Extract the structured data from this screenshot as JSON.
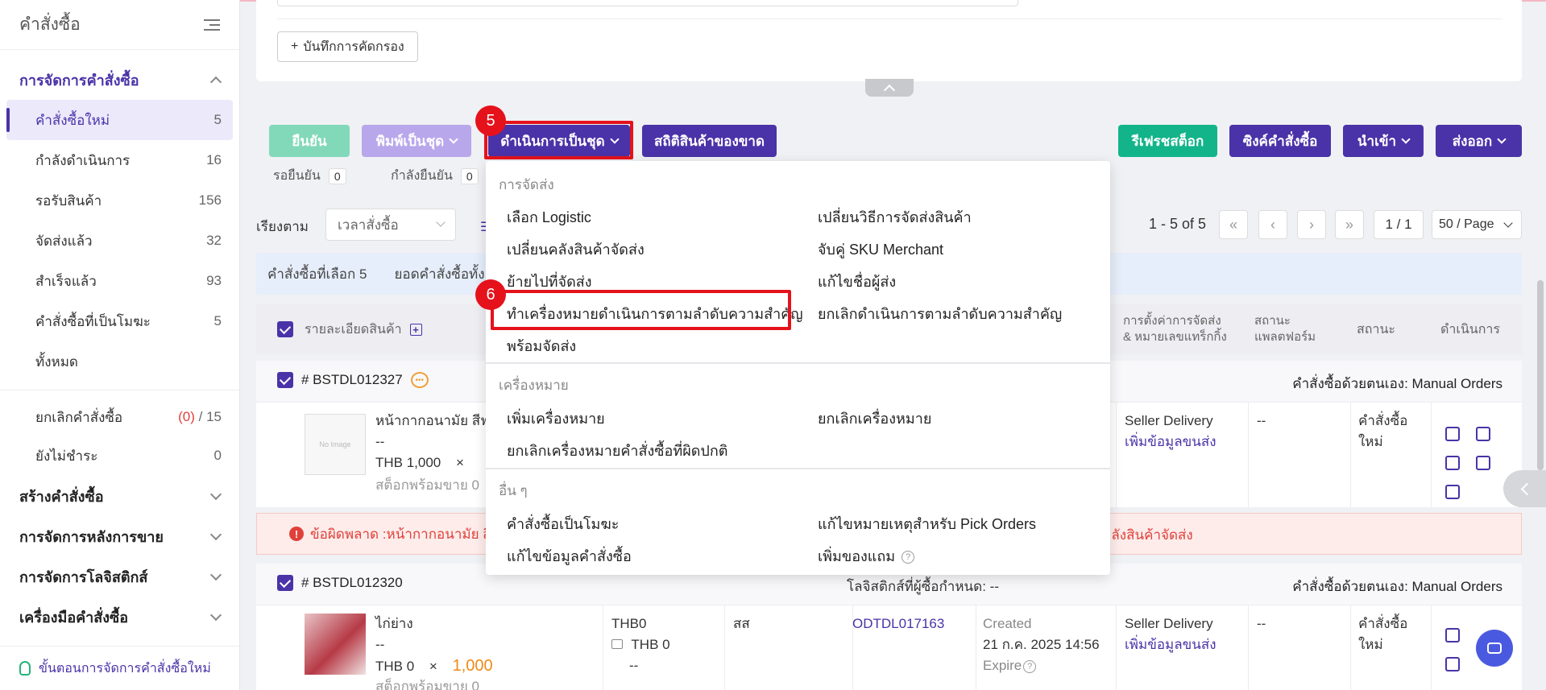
{
  "sidebar": {
    "title": "คำสั่งซื้อ",
    "group_manage": "การจัดการคำสั่งซื้อ",
    "items": [
      {
        "label": "คำสั่งซื้อใหม่",
        "count": "5"
      },
      {
        "label": "กำลังดำเนินการ",
        "count": "16"
      },
      {
        "label": "รอรับสินค้า",
        "count": "156"
      },
      {
        "label": "จัดส่งแล้ว",
        "count": "32"
      },
      {
        "label": "สำเร็จแล้ว",
        "count": "93"
      },
      {
        "label": "คำสั่งซื้อที่เป็นโมฆะ",
        "count": "5"
      },
      {
        "label": "ทั้งหมด",
        "count": ""
      }
    ],
    "cancel": {
      "label": "ยกเลิกคำสั่งซื้อ",
      "pending": "(0)",
      "slash": "/",
      "total": "15"
    },
    "unpaid": {
      "label": "ยังไม่ชำระ",
      "count": "0"
    },
    "groups": [
      "สร้างคำสั่งซื้อ",
      "การจัดการหลังการขาย",
      "การจัดการโลจิสติกส์",
      "เครื่องมือคำสั่งซื้อ"
    ],
    "footer": "ขั้นตอนการจัดการคำสั่งซื้อใหม่"
  },
  "filter": {
    "save_label": "บันทึกการคัดกรอง",
    "plus": "+"
  },
  "toolbar": {
    "confirm": "ยืนยัน",
    "print_batch": "พิมพ์เป็นชุด",
    "batch_process": "ดำเนินการเป็นชุด",
    "stock_stats": "สถิติสินค้าของขาด",
    "refresh_stock": "รีเฟรชสต็อก",
    "sync_orders": "ซิงค์คำสั่งซื้อ",
    "import": "นำเข้า",
    "export": "ส่งออก",
    "step5": "5",
    "step6": "6"
  },
  "status": {
    "pending_label": "รอยืนยัน",
    "pending_count": "0",
    "confirming_label": "กำลังยืนยัน",
    "confirming_count": "0"
  },
  "sort": {
    "label": "เรียงตาม",
    "value": "เวลาสั่งซื้อ",
    "icon": "☰"
  },
  "pager": {
    "summary": "1 - 5 of 5",
    "first": "«",
    "prev": "‹",
    "next": "›",
    "last": "»",
    "page": "1 / 1",
    "size": "50 / Page"
  },
  "selection": {
    "selected": "คำสั่งซื้อที่เลือก 5",
    "total": "ยอดคำสั่งซื้อทั้ง"
  },
  "table": {
    "col_product": "รายละเอียดสินค้า",
    "col_shipping_l1": "การตั้งค่าการจัดส่ง",
    "col_shipping_l2": "& หมายเลขแทร็กกิ้ง",
    "col_platform_l1": "สถานะ",
    "col_platform_l2": "แพลตฟอร์ม",
    "col_status": "สถานะ",
    "col_actions": "ดำเนินการ"
  },
  "orders": [
    {
      "id": "# BSTDL012327",
      "source": "คำสั่งซื้อด้วยตนเอง: Manual Orders",
      "product": "หน้ากากอนามัย สีฟ",
      "variant": "--",
      "price": "THB 1,000",
      "times": "×",
      "stock": "สต็อกพร้อมขาย 0",
      "no_image": "No Image",
      "delivery": "Seller Delivery",
      "add_info": "เพิ่มข้อมูลขนส่ง",
      "platform_status": "--",
      "status_l1": "คำสั่งซื้อ",
      "status_l2": "ใหม่"
    },
    {
      "id": "# BSTDL012320",
      "logistics": "โลจิสติกส์ที่ผู้ซื้อกำหนด: --",
      "source": "คำสั่งซื้อด้วยตนเอง: Manual Orders",
      "product": "ไก่ย่าง",
      "variant": "--",
      "price": "THB 0",
      "times": "×",
      "qty": "1,000",
      "stock": "สต็อกพร้อมขาย 0",
      "amount": "THB0",
      "amount2": "THB 0",
      "amount3": "--",
      "unit": "สส",
      "ref": "ODTDL017163",
      "created_label": "Created",
      "created_date": "21 ก.ค. 2025 14:56",
      "expire": "Expire",
      "delivery": "Seller Delivery",
      "add_info": "เพิ่มข้อมูลขนส่ง",
      "platform_status": "--",
      "status_l1": "คำสั่งซื้อ",
      "status_l2": "ใหม่"
    }
  ],
  "error": {
    "icon": "!",
    "text": "ข้อผิดพลาด :หน้ากากอนามัย สี",
    "tail": "คลังสินค้าจัดส่ง"
  },
  "dropdown": {
    "sec_shipping": "การจัดส่ง",
    "select_logistic": "เลือก Logistic",
    "change_method": "เปลี่ยนวิธีการจัดส่งสินค้า",
    "change_warehouse": "เปลี่ยนคลังสินค้าจัดส่ง",
    "match_sku": "จับคู่ SKU Merchant",
    "move_to_ship": "ย้ายไปที่จัดส่ง",
    "edit_sender": "แก้ไขชื่อผู้ส่ง",
    "mark_priority": "ทำเครื่องหมายดำเนินการตามลำดับความสำคัญ",
    "cancel_priority": "ยกเลิกดำเนินการตามลำดับความสำคัญ",
    "ready_ship": "พร้อมจัดส่ง",
    "sec_mark": "เครื่องหมาย",
    "add_mark": "เพิ่มเครื่องหมาย",
    "remove_mark": "ยกเลิกเครื่องหมาย",
    "remove_abnormal": "ยกเลิกเครื่องหมายคำสั่งซื้อที่ผิดปกติ",
    "sec_other": "อื่น ๆ",
    "void_order": "คำสั่งซื้อเป็นโมฆะ",
    "edit_pick_note": "แก้ไขหมายเหตุสำหรับ Pick Orders",
    "edit_order_info": "แก้ไขข้อมูลคำสั่งซื้อ",
    "add_gift": "เพิ่มของแถม",
    "qmark": "?"
  },
  "colors": {
    "primary": "#4a33a8",
    "confirm": "#82d9ba",
    "print": "#b9a7ec",
    "refresh": "#13b48a",
    "error": "#e0403a",
    "highlight": "#e5121b"
  }
}
